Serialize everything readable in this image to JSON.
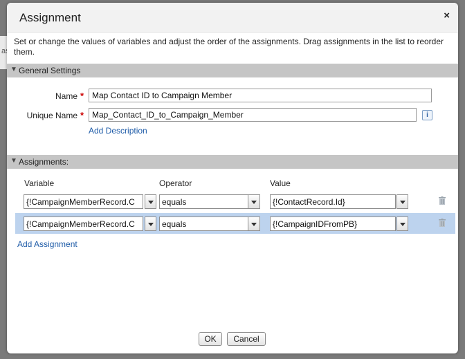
{
  "background": {
    "partial_text": "as"
  },
  "dialog": {
    "title": "Assignment",
    "close_symbol": "×",
    "description": "Set or change the values of variables and adjust the order of the assignments. Drag assignments in the list to reorder them."
  },
  "general_settings": {
    "header": "General Settings",
    "name_label": "Name",
    "name_value": "Map Contact ID to Campaign Member",
    "unique_name_label": "Unique Name",
    "unique_name_value": "Map_Contact_ID_to_Campaign_Member",
    "required_marker": "*",
    "info_symbol": "i",
    "add_description": "Add Description"
  },
  "assignments": {
    "header": "Assignments:",
    "columns": {
      "variable": "Variable",
      "operator": "Operator",
      "value": "Value"
    },
    "rows": [
      {
        "variable": "{!CampaignMemberRecord.C",
        "operator": "equals",
        "value": "{!ContactRecord.Id}"
      },
      {
        "variable": "{!CampaignMemberRecord.C",
        "operator": "equals",
        "value": "{!CampaignIDFromPB}"
      }
    ],
    "add_assignment": "Add Assignment"
  },
  "footer": {
    "ok": "OK",
    "cancel": "Cancel"
  },
  "colors": {
    "link": "#1f5ca8",
    "required": "#cc0000",
    "selected_row": "#bdd3ee",
    "section_bar": "#c5c5c5"
  },
  "icons": [
    "close-icon",
    "collapse-triangle-icon",
    "info-icon",
    "dropdown-arrow-icon",
    "trash-icon"
  ]
}
